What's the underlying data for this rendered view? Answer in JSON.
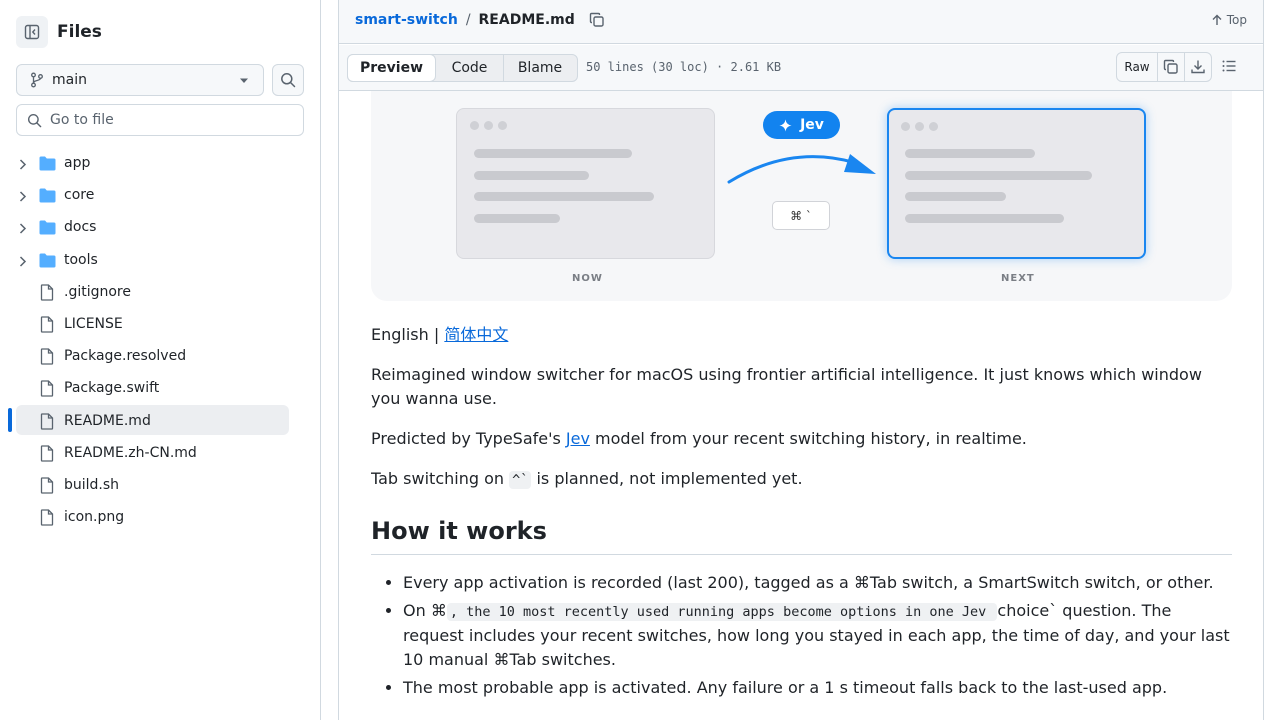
{
  "sidebar": {
    "title": "Files",
    "branch": "main",
    "goto_placeholder": "Go to file",
    "items": [
      {
        "label": "app",
        "type": "folder"
      },
      {
        "label": "core",
        "type": "folder"
      },
      {
        "label": "docs",
        "type": "folder"
      },
      {
        "label": "tools",
        "type": "folder"
      },
      {
        "label": ".gitignore",
        "type": "file"
      },
      {
        "label": "LICENSE",
        "type": "file"
      },
      {
        "label": "Package.resolved",
        "type": "file"
      },
      {
        "label": "Package.swift",
        "type": "file"
      },
      {
        "label": "README.md",
        "type": "file",
        "selected": true
      },
      {
        "label": "README.zh-CN.md",
        "type": "file"
      },
      {
        "label": "build.sh",
        "type": "file"
      },
      {
        "label": "icon.png",
        "type": "file"
      }
    ]
  },
  "header": {
    "repo": "smart-switch",
    "separator": "/",
    "file": "README.md",
    "top_label": "Top"
  },
  "filebar": {
    "tabs": [
      "Preview",
      "Code",
      "Blame"
    ],
    "active_tab": "Preview",
    "info": "50 lines (30 loc) · 2.61 KB",
    "raw_label": "Raw"
  },
  "hero": {
    "pill_label": "Jev",
    "shortcut": "⌘ `",
    "now_label": "NOW",
    "next_label": "NEXT"
  },
  "readme": {
    "lang_current": "English |",
    "lang_link": "简体中文",
    "intro": "Reimagined window switcher for macOS using frontier artificial intelligence. It just knows which window you wanna use.",
    "predicted_pre": "Predicted by TypeSafe's ",
    "predicted_link": "Jev",
    "predicted_post": " model from your recent switching history, in realtime.",
    "tab_pre": "Tab switching on ",
    "tab_code": "^`",
    "tab_post": " is planned, not implemented yet.",
    "h2": "How it works",
    "li1": "Every app activation is recorded (last 200), tagged as a ⌘Tab switch, a SmartSwitch switch, or other.",
    "li2_pre": "On ⌘",
    "li2_code": ", the 10 most recently used running apps become options in one Jev ",
    "li2_post": "choice` question. The request includes your recent switches, how long you stayed in each app, the time of day, and your last 10 manual ⌘Tab switches.",
    "li3": "The most probable app is activated. Any failure or a 1 s timeout falls back to the last-used app."
  },
  "colors": {
    "accent": "#0969da",
    "pill": "#1283ef",
    "folder": "#54aeff"
  }
}
